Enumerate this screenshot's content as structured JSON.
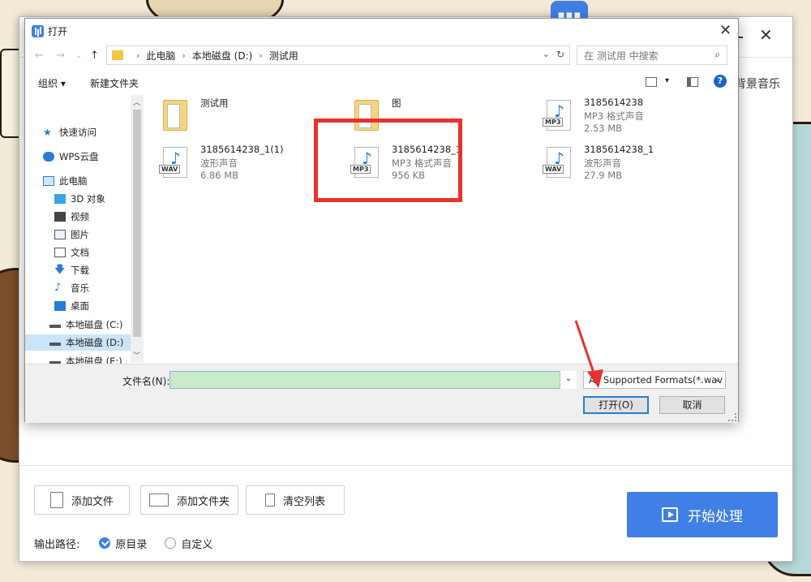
{
  "app": {
    "side_label": "背景音乐",
    "buttons": {
      "add_file": "添加文件",
      "add_folder": "添加文件夹",
      "clear_list": "清空列表",
      "start": "开始处理"
    },
    "output": {
      "label": "输出路径:",
      "option_original": "原目录",
      "option_custom": "自定义",
      "selected": "原目录"
    }
  },
  "dialog": {
    "title": "打开",
    "breadcrumb": [
      "此电脑",
      "本地磁盘 (D:)",
      "测试用"
    ],
    "search_placeholder": "在 测试用 中搜索",
    "toolbar": {
      "organize": "组织 ▾",
      "new_folder": "新建文件夹"
    },
    "sidebar": [
      {
        "label": "快速访问",
        "icon": "star-icon"
      },
      {
        "label": "WPS云盘",
        "icon": "cloud-icon"
      },
      {
        "label": "此电脑",
        "icon": "computer-icon"
      },
      {
        "label": "3D 对象",
        "icon": "cube-icon"
      },
      {
        "label": "视频",
        "icon": "video-icon"
      },
      {
        "label": "图片",
        "icon": "picture-icon"
      },
      {
        "label": "文档",
        "icon": "document-icon"
      },
      {
        "label": "下载",
        "icon": "download-icon"
      },
      {
        "label": "音乐",
        "icon": "music-icon"
      },
      {
        "label": "桌面",
        "icon": "desktop-icon"
      },
      {
        "label": "本地磁盘 (C:)",
        "icon": "drive-icon"
      },
      {
        "label": "本地磁盘 (D:)",
        "icon": "drive-icon"
      },
      {
        "label": "本地磁盘 (E:)",
        "icon": "drive-icon"
      }
    ],
    "selected_sidebar": "本地磁盘 (D:)",
    "files": [
      {
        "name": "测试用",
        "type": "",
        "size": "",
        "kind": "folder",
        "tag": ""
      },
      {
        "name": "图",
        "type": "",
        "size": "",
        "kind": "folder",
        "tag": ""
      },
      {
        "name": "3185614238",
        "type": "MP3 格式声音",
        "size": "2.53 MB",
        "kind": "audio",
        "tag": "MP3"
      },
      {
        "name": "3185614238_1(1)",
        "type": "波形声音",
        "size": "6.86 MB",
        "kind": "audio",
        "tag": "WAV"
      },
      {
        "name": "3185614238_1",
        "type": "MP3 格式声音",
        "size": "956 KB",
        "kind": "audio",
        "tag": "MP3"
      },
      {
        "name": "3185614238_1",
        "type": "波形声音",
        "size": "27.9 MB",
        "kind": "audio",
        "tag": "WAV"
      }
    ],
    "filename_label": "文件名(N):",
    "filename_value": "",
    "filter": "All Supported Formats(*.wav",
    "open_button": "打开(O)",
    "cancel_button": "取消"
  },
  "colors": {
    "accent": "#3f7fe6",
    "highlight": "#e8322d",
    "filename_bg": "#c9ebc9"
  }
}
